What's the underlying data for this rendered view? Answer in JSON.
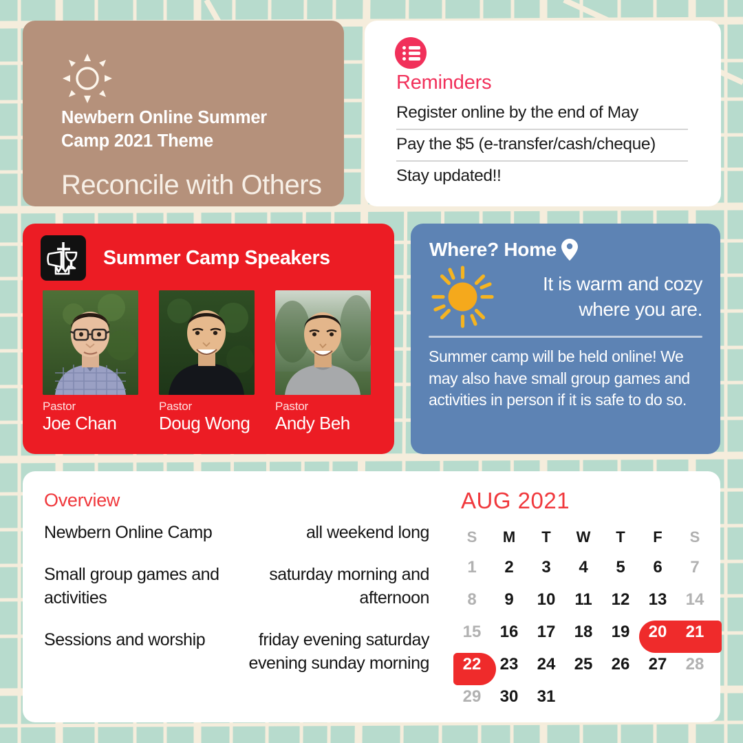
{
  "theme": {
    "icon": "sun-outline-icon",
    "subtitle": "Newbern Online Summer Camp 2021 Theme",
    "subtitle_line1": "Newbern Online Summer",
    "subtitle_line2": "Camp 2021 Theme",
    "title": "Reconcile with Others",
    "bg_color": "#b5917b",
    "text_color": "#ffffff"
  },
  "reminders": {
    "icon": "list-icon",
    "title": "Reminders",
    "accent_color": "#f1305a",
    "items": [
      "Register online by the end of May",
      "Pay the $5 (e-transfer/cash/cheque)",
      "Stay updated!!"
    ]
  },
  "speakers": {
    "logo": "church-cross-chalice-logo",
    "title": "Summer Camp Speakers",
    "bg_color": "#ec1c24",
    "people": [
      {
        "role": "Pastor",
        "name": "Joe Chan",
        "photo": "portrait-man-glasses-plaid-shirt"
      },
      {
        "role": "Pastor",
        "name": "Doug Wong",
        "photo": "portrait-man-black-shirt"
      },
      {
        "role": "Pastor",
        "name": "Andy Beh",
        "photo": "portrait-man-grey-sweater"
      }
    ]
  },
  "where": {
    "title": "Where? Home",
    "pin_icon": "location-pin-icon",
    "sun_icon": "sun-filled-icon",
    "tagline_line1": "It is warm and cozy",
    "tagline_line2": "where you are.",
    "body": "Summer camp will be held online! We may also have small group games and activities in person if it is safe to do so.",
    "bg_color": "#5d83b4"
  },
  "overview": {
    "title": "Overview",
    "accent_color": "#f0383c",
    "rows": [
      {
        "activity": "Newbern Online Camp",
        "time": "all weekend long"
      },
      {
        "activity": "Small group games and activities",
        "time": "saturday morning and afternoon"
      },
      {
        "activity": "Sessions and worship",
        "time": "friday evening saturday evening sunday morning"
      }
    ]
  },
  "calendar": {
    "title": "AUG 2021",
    "accent_color": "#ef2b2b",
    "weekdays": [
      "S",
      "M",
      "T",
      "W",
      "T",
      "F",
      "S"
    ],
    "weekend_indices": [
      0,
      6
    ],
    "days": [
      [
        "1",
        "2",
        "3",
        "4",
        "5",
        "6",
        "7"
      ],
      [
        "8",
        "9",
        "10",
        "11",
        "12",
        "13",
        "14"
      ],
      [
        "15",
        "16",
        "17",
        "18",
        "19",
        "20",
        "21"
      ],
      [
        "22",
        "23",
        "24",
        "25",
        "26",
        "27",
        "28"
      ],
      [
        "29",
        "30",
        "31",
        "",
        "",
        "",
        ""
      ]
    ],
    "highlighted_days": [
      "20",
      "21",
      "22"
    ]
  },
  "background": {
    "map_color": "#b7dbcd",
    "road_color": "#f5eddc"
  }
}
